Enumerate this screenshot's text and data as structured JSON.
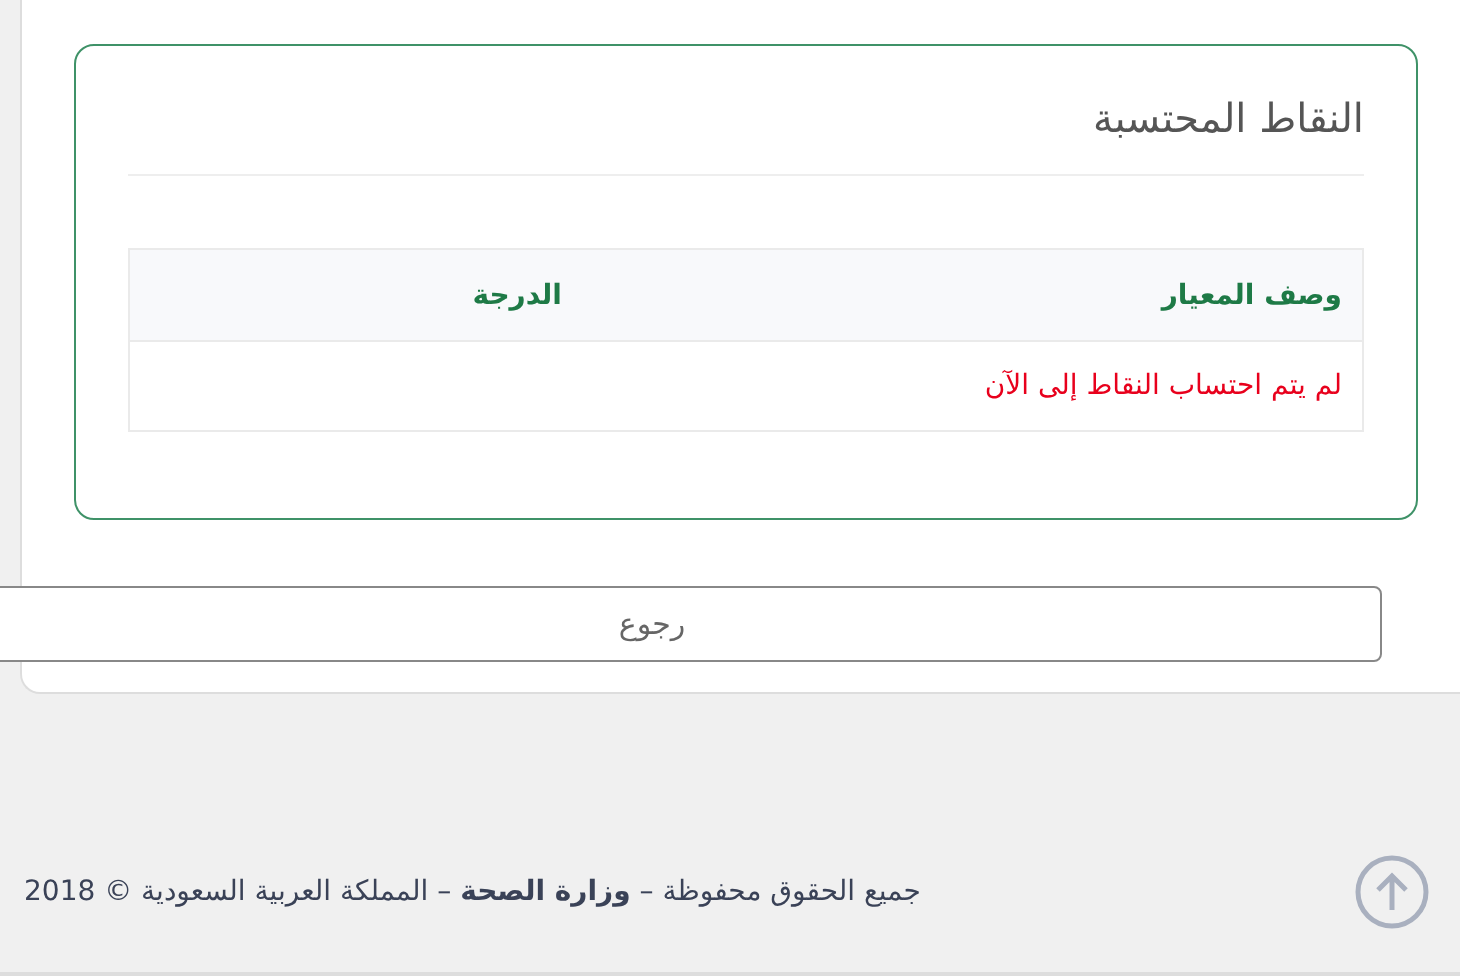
{
  "panel": {
    "title": "النقاط المحتسبة",
    "table": {
      "columns": [
        "وصف المعيار",
        "الدرجة"
      ],
      "empty_message": "لم يتم احتساب النقاط إلى الآن"
    }
  },
  "back_button": "رجوع",
  "footer": "جميع الحقوق محفوظة – **وزارة الصحة** – المملكة العربية السعودية © 2018"
}
